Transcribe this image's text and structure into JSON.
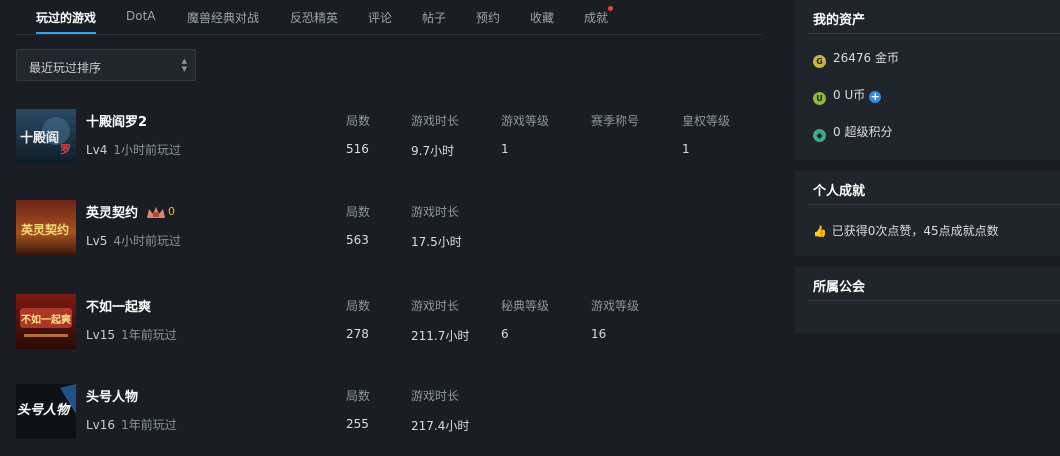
{
  "tabs": [
    {
      "label": "玩过的游戏"
    },
    {
      "label": "DotA"
    },
    {
      "label": "魔兽经典对战"
    },
    {
      "label": "反恐精英"
    },
    {
      "label": "评论"
    },
    {
      "label": "帖子"
    },
    {
      "label": "预约"
    },
    {
      "label": "收藏"
    },
    {
      "label": "成就"
    }
  ],
  "sort": {
    "label": "最近玩过排序"
  },
  "games": [
    {
      "name": "十殿阎罗2",
      "level": "Lv4",
      "last_played": "1小时前玩过",
      "thumb_text": "十殿阎罗",
      "stats": [
        {
          "header": "局数",
          "value": "516"
        },
        {
          "header": "游戏时长",
          "value": "9.7小时"
        },
        {
          "header": "游戏等级",
          "value": "1"
        },
        {
          "header": "赛季称号",
          "value": ""
        },
        {
          "header": "皇权等级",
          "value": "1"
        }
      ]
    },
    {
      "name": "英灵契约",
      "level": "Lv5",
      "last_played": "4小时前玩过",
      "thumb_text": "英灵契约",
      "badge_value": "0",
      "stats": [
        {
          "header": "局数",
          "value": "563"
        },
        {
          "header": "游戏时长",
          "value": "17.5小时"
        }
      ]
    },
    {
      "name": "不如一起爽",
      "level": "Lv15",
      "last_played": "1年前玩过",
      "thumb_text": "不如一起爽",
      "stats": [
        {
          "header": "局数",
          "value": "278"
        },
        {
          "header": "游戏时长",
          "value": "211.7小时"
        },
        {
          "header": "秘典等级",
          "value": "6"
        },
        {
          "header": "游戏等级",
          "value": "16"
        }
      ]
    },
    {
      "name": "头号人物",
      "level": "Lv16",
      "last_played": "1年前玩过",
      "thumb_text": "头号人物",
      "stats": [
        {
          "header": "局数",
          "value": "255"
        },
        {
          "header": "游戏时长",
          "value": "217.4小时"
        }
      ]
    }
  ],
  "assets": {
    "title": "我的资产",
    "gold": "26476 金币",
    "ucoin": "0 U币",
    "points": "0 超级积分"
  },
  "achievement": {
    "title": "个人成就",
    "text": "已获得0次点赞，45点成就点数"
  },
  "guild": {
    "title": "所属公会"
  },
  "colors": {
    "accent": "#3aa0e8",
    "notify_dot": "#e8443a",
    "gold": "#c9b44a",
    "ucoin": "#4caf50",
    "points": "#3fa98a"
  }
}
